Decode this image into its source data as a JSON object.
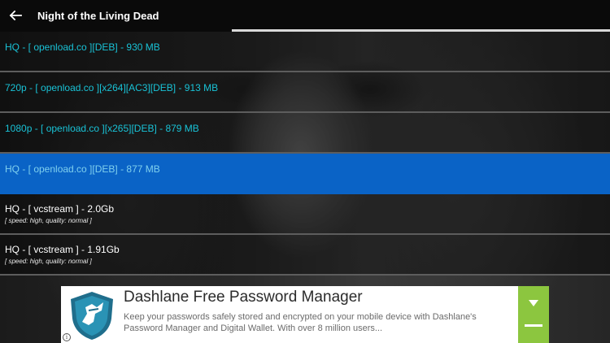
{
  "header": {
    "title": "Night of the Living Dead",
    "back_icon": "arrow-left-icon"
  },
  "loading_progress": 0.62,
  "sources": [
    {
      "label": "HQ  - [ openload.co ][DEB] - 930 MB",
      "sub": ""
    },
    {
      "label": "720p  - [ openload.co ][x264][AC3][DEB] - 913 MB",
      "sub": ""
    },
    {
      "label": "1080p  - [ openload.co ][x265][DEB] - 879 MB",
      "sub": ""
    },
    {
      "label": "HQ  - [ openload.co ][DEB] - 877 MB",
      "sub": ""
    },
    {
      "label": "HQ  - [ vcstream ] - 2.0Gb",
      "sub": "[ speed: high, quality: normal ]"
    },
    {
      "label": "HQ  - [ vcstream ] - 1.91Gb",
      "sub": "[ speed: high, quality: normal ]"
    }
  ],
  "selected_index": 3,
  "ad": {
    "headline": "Dashlane Free Password Manager",
    "body": "Keep your passwords safely stored and encrypted on your mobile device with Dashlane's Password Manager and Digital Wallet. With over 8 million users...",
    "info_glyph": "i",
    "logo_icon": "dashlane-shield-icon",
    "cta_icon": "chevron-down-icon",
    "colors": {
      "cta": "#8cc63f",
      "logo": "#1f6e8c"
    }
  },
  "colors": {
    "link_text": "#19c2d6",
    "selected_row": "#0a63c6",
    "topbar": "#0a0a0a"
  }
}
